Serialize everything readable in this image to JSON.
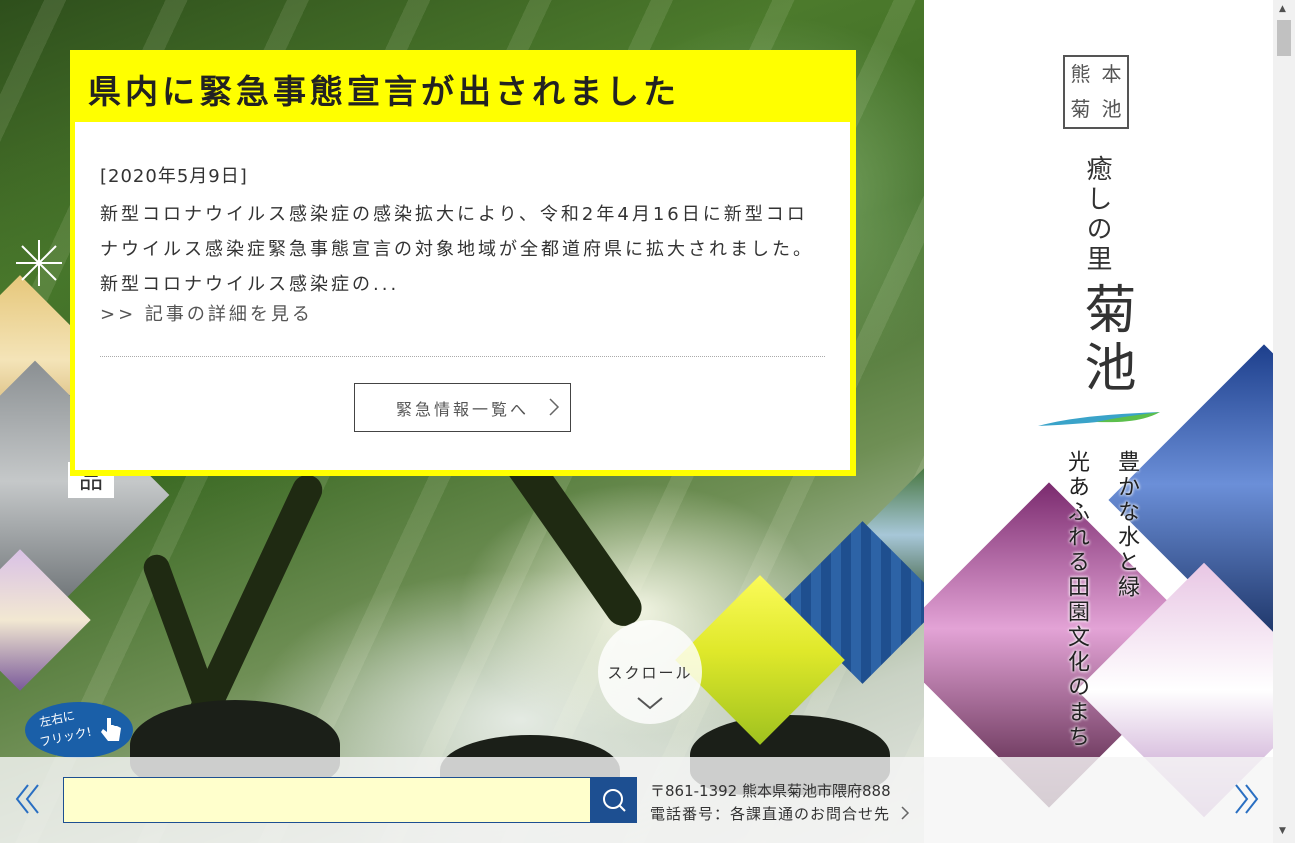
{
  "notice": {
    "title": "県内に緊急事態宣言が出されました",
    "date": "[2020年5月9日]",
    "text": "新型コロナウイルス感染症の感染拡大により、令和2年4月16日に新型コロナウイルス感染症緊急事態宣言の対象地域が全都道府県に拡大されました。新型コロナウイルス感染症の...",
    "more_link": ">> 記事の詳細を見る",
    "list_button": "緊急情報一覧へ"
  },
  "branding": {
    "seal_chars": [
      "菊",
      "池",
      "熊",
      "本"
    ],
    "tagline": "癒しの里",
    "city_name": "菊池",
    "slogan_line1": "豊かな水と緑",
    "slogan_line2": "光あふれる田園文化のまち"
  },
  "hero": {
    "scroll_label": "スクロール",
    "flick_badge_line1": "左右に",
    "flick_badge_line2": "フリック!"
  },
  "footer": {
    "search_placeholder": "",
    "address": "〒861-1392 熊本県菊池市隈府888",
    "phone_label": "電話番号：",
    "phone_link": "各課直通のお問合せ先"
  },
  "colors": {
    "notice_yellow": "#ffff00",
    "brand_blue": "#1d4f91",
    "search_bg": "#ffffcc"
  }
}
